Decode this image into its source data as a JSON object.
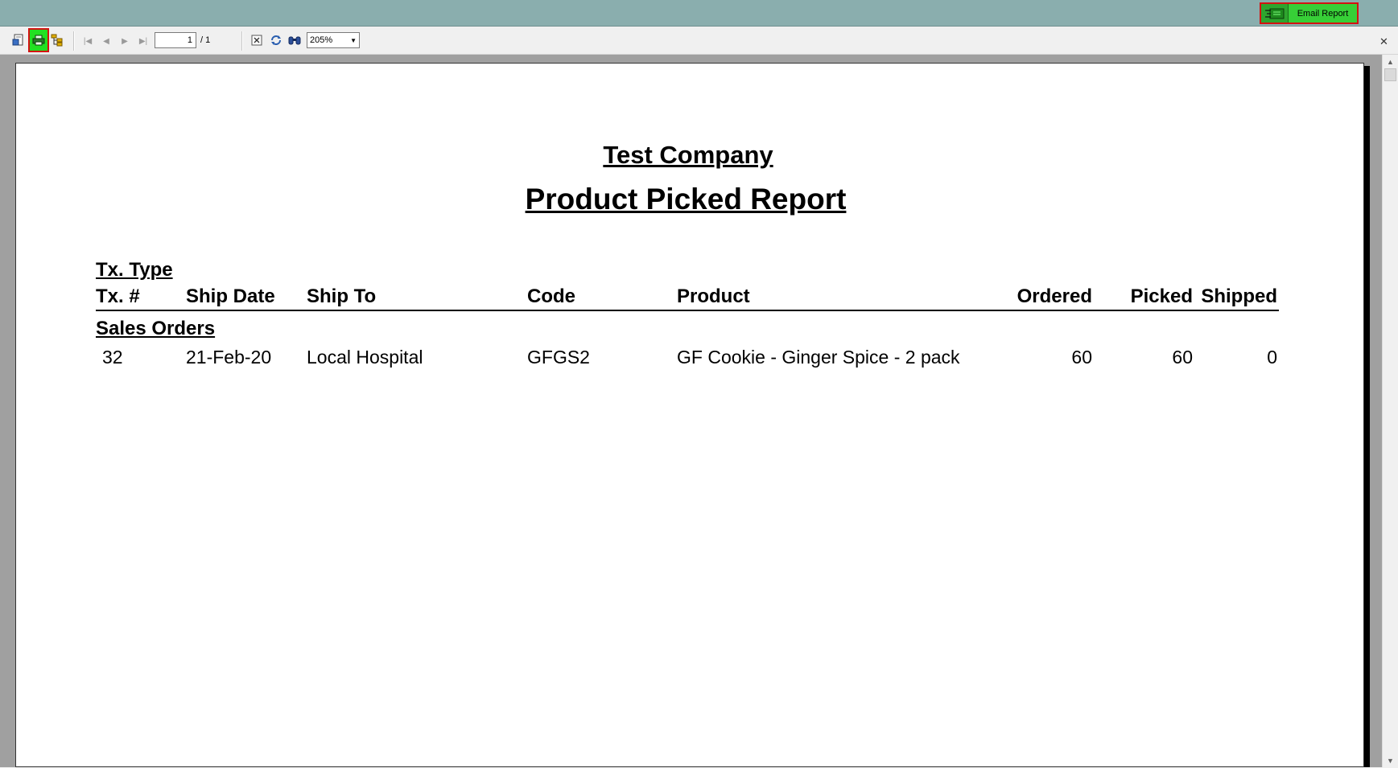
{
  "topbar": {
    "email_button_label": "Email Report",
    "email_icon": "email-report-icon"
  },
  "toolbar": {
    "icons": [
      "export-icon",
      "print-icon",
      "group-tree-icon",
      "first-page-icon",
      "previous-page-icon",
      "next-page-icon",
      "last-page-icon",
      "close-view-icon",
      "refresh-icon",
      "find-icon",
      "close-icon"
    ],
    "current_page": "1",
    "page_total": "/ 1",
    "zoom": "205%"
  },
  "report": {
    "company": "Test Company",
    "title": "Product Picked Report",
    "group_header_label": "Tx. Type",
    "columns": {
      "tx_no": "Tx. #",
      "ship_date": "Ship Date",
      "ship_to": "Ship To",
      "code": "Code",
      "product": "Product",
      "ordered": "Ordered",
      "picked": "Picked",
      "shipped": "Shipped"
    },
    "group_name": "Sales Orders",
    "rows": [
      {
        "tx_no": "32",
        "ship_date": "21-Feb-20",
        "ship_to": "Local Hospital",
        "code": "GFGS2",
        "product": "GF Cookie - Ginger Spice - 2 pack",
        "ordered": "60",
        "picked": "60",
        "shipped": "0"
      }
    ]
  },
  "colors": {
    "topbar": "#8aaeae",
    "highlight_green": "#22e022",
    "highlight_border": "#d41111"
  }
}
